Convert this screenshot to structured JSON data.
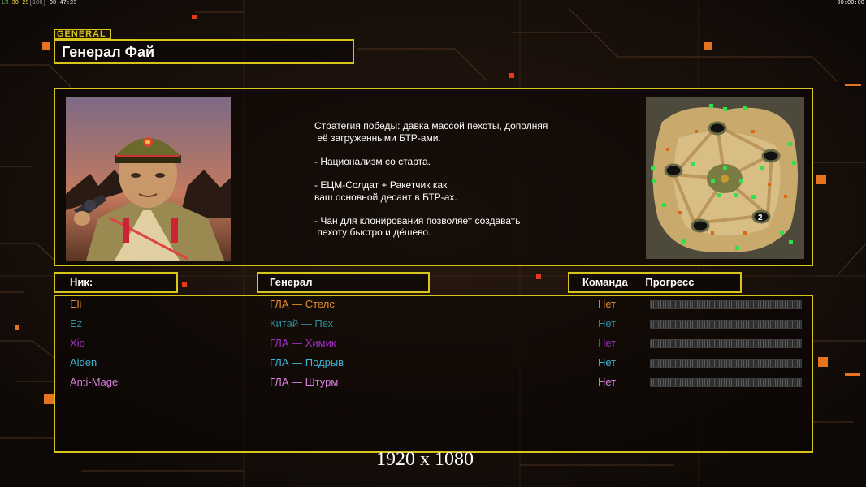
{
  "hud": {
    "left_prefix": "LR",
    "left_fps": "30 29",
    "left_bracket": "[100]",
    "left_time": "00:47:23",
    "right_time": "00:00:00"
  },
  "general_tag": "GENERAL",
  "title": "Генерал Фай",
  "description": "Стратегия победы: давка массой пехоты, дополняя\n её загруженными БТР-ами.\n\n- Национализм со старта.\n\n- ЕЦМ-Солдат + Ракетчик как\nваш основной десант в БТР-ах.\n\n- Чан для клонирования позволяет создавать\n пехоту быстро и дёшево.",
  "headers": {
    "nick": "Ник:",
    "general": "Генерал",
    "team": "Команда",
    "progress": "Прогресс"
  },
  "players": [
    {
      "name": "Eli",
      "general": "ГЛА — Стелс",
      "team": "Нет",
      "color": "#e58a2e",
      "team_color": "#e58a2e",
      "progress": 0
    },
    {
      "name": "Ez",
      "general": "Китай — Пех",
      "team": "Нет",
      "color": "#2b8fa0",
      "team_color": "#2b8fa0",
      "progress": 0
    },
    {
      "name": "Xio",
      "general": "ГЛА — Химик",
      "team": "Нет",
      "color": "#a22ec4",
      "team_color": "#a22ec4",
      "progress": 0
    },
    {
      "name": "Aiden",
      "general": "ГЛА — Подрыв",
      "team": "Нет",
      "color": "#3bb6d6",
      "team_color": "#3bb6d6",
      "progress": 0
    },
    {
      "name": "Anti-Mage",
      "general": "ГЛА — Штурм",
      "team": "Нет",
      "color": "#d67fe0",
      "team_color": "#d67fe0",
      "progress": 0
    }
  ],
  "map_marker": "2",
  "resolution": "1920 x 1080",
  "colors": {
    "frame": "#d8c51c",
    "accent_orange": "#e8731f",
    "accent_red": "#e23a1a",
    "background": "#150e0a"
  }
}
